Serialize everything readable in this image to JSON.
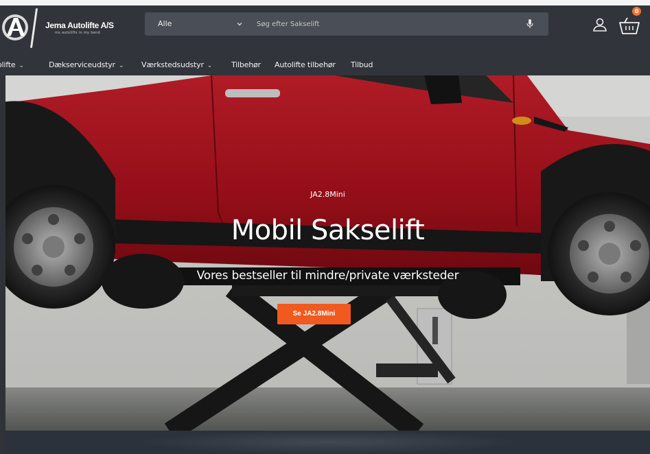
{
  "header": {
    "logo_name": "Jema Autolifte A/S",
    "logo_tagline": "ms autolifts in my bend",
    "search": {
      "category": "Alle",
      "placeholder": "Søg efter Sakselift"
    },
    "cart_count": "0"
  },
  "nav": {
    "items": [
      {
        "label": "olifte",
        "has_dropdown": true
      },
      {
        "label": "Dækserviceudstyr",
        "has_dropdown": true
      },
      {
        "label": "Værkstedsudstyr",
        "has_dropdown": true
      },
      {
        "label": "Tilbehør",
        "has_dropdown": false
      },
      {
        "label": "Autolifte tilbehør",
        "has_dropdown": false
      },
      {
        "label": "Tilbud",
        "has_dropdown": false
      }
    ]
  },
  "hero": {
    "subtitle": "JA2.8Mini",
    "title": "Mobil Sakselift",
    "description": "Vores bestseller til mindre/private værksteder",
    "button_label": "Se JA2.8Mini",
    "lift_brand": "Jema Autolifte A/S"
  },
  "colors": {
    "header_bg": "#31343a",
    "search_bg": "#4a4e56",
    "accent": "#f05a1e",
    "car": "#b3121f"
  }
}
